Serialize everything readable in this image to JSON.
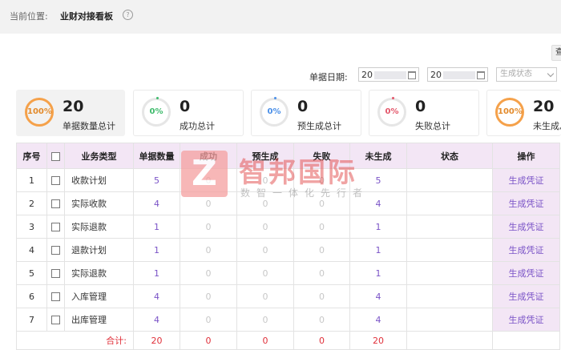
{
  "breadcrumb": {
    "label": "当前位置:",
    "current": "业财对接看板",
    "help_icon": "question-circle-icon"
  },
  "edge_button_text": "查",
  "filters": {
    "date_label": "单据日期:",
    "date_start": "20",
    "date_end": "20",
    "status_placeholder": "生成状态",
    "calendar_icon": "calendar-icon",
    "select_icon": "chevron-down-icon"
  },
  "cards": [
    {
      "percent": "100%",
      "value": "20",
      "label": "单据数量总计"
    },
    {
      "percent": "0%",
      "value": "0",
      "label": "成功总计"
    },
    {
      "percent": "0%",
      "value": "0",
      "label": "预生成总计"
    },
    {
      "percent": "0%",
      "value": "0",
      "label": "失败总计"
    },
    {
      "percent": "100%",
      "value": "20",
      "label": "未生成总计"
    }
  ],
  "table": {
    "headers": [
      "序号",
      "",
      "业务类型",
      "单据数量",
      "成功",
      "预生成",
      "失败",
      "未生成",
      "状态",
      "操作"
    ],
    "rows": [
      {
        "no": "1",
        "type": "收款计划",
        "count": "5",
        "success": "0",
        "pre": "0",
        "fail": "0",
        "pending": "5",
        "status": "",
        "action": "生成凭证"
      },
      {
        "no": "2",
        "type": "实际收款",
        "count": "4",
        "success": "0",
        "pre": "0",
        "fail": "0",
        "pending": "4",
        "status": "",
        "action": "生成凭证"
      },
      {
        "no": "3",
        "type": "实际退款",
        "count": "1",
        "success": "0",
        "pre": "0",
        "fail": "0",
        "pending": "1",
        "status": "",
        "action": "生成凭证"
      },
      {
        "no": "4",
        "type": "退款计划",
        "count": "1",
        "success": "0",
        "pre": "0",
        "fail": "0",
        "pending": "1",
        "status": "",
        "action": "生成凭证"
      },
      {
        "no": "5",
        "type": "实际退款",
        "count": "1",
        "success": "0",
        "pre": "0",
        "fail": "0",
        "pending": "1",
        "status": "",
        "action": "生成凭证"
      },
      {
        "no": "6",
        "type": "入库管理",
        "count": "4",
        "success": "0",
        "pre": "0",
        "fail": "0",
        "pending": "4",
        "status": "",
        "action": "生成凭证"
      },
      {
        "no": "7",
        "type": "出库管理",
        "count": "4",
        "success": "0",
        "pre": "0",
        "fail": "0",
        "pending": "4",
        "status": "",
        "action": "生成凭证"
      }
    ],
    "total": {
      "label": "合计:",
      "count": "20",
      "success": "0",
      "pre": "0",
      "fail": "0",
      "pending": "20"
    }
  },
  "watermark": {
    "logo_letter": "Z",
    "name": "智邦国际",
    "slogan": "数智一体化先行者"
  },
  "colors": {
    "header_bg": "#f3e6f5",
    "accent": "#7a53c7",
    "total_red": "#e0303a",
    "ring_orange": "#f5a14a"
  }
}
